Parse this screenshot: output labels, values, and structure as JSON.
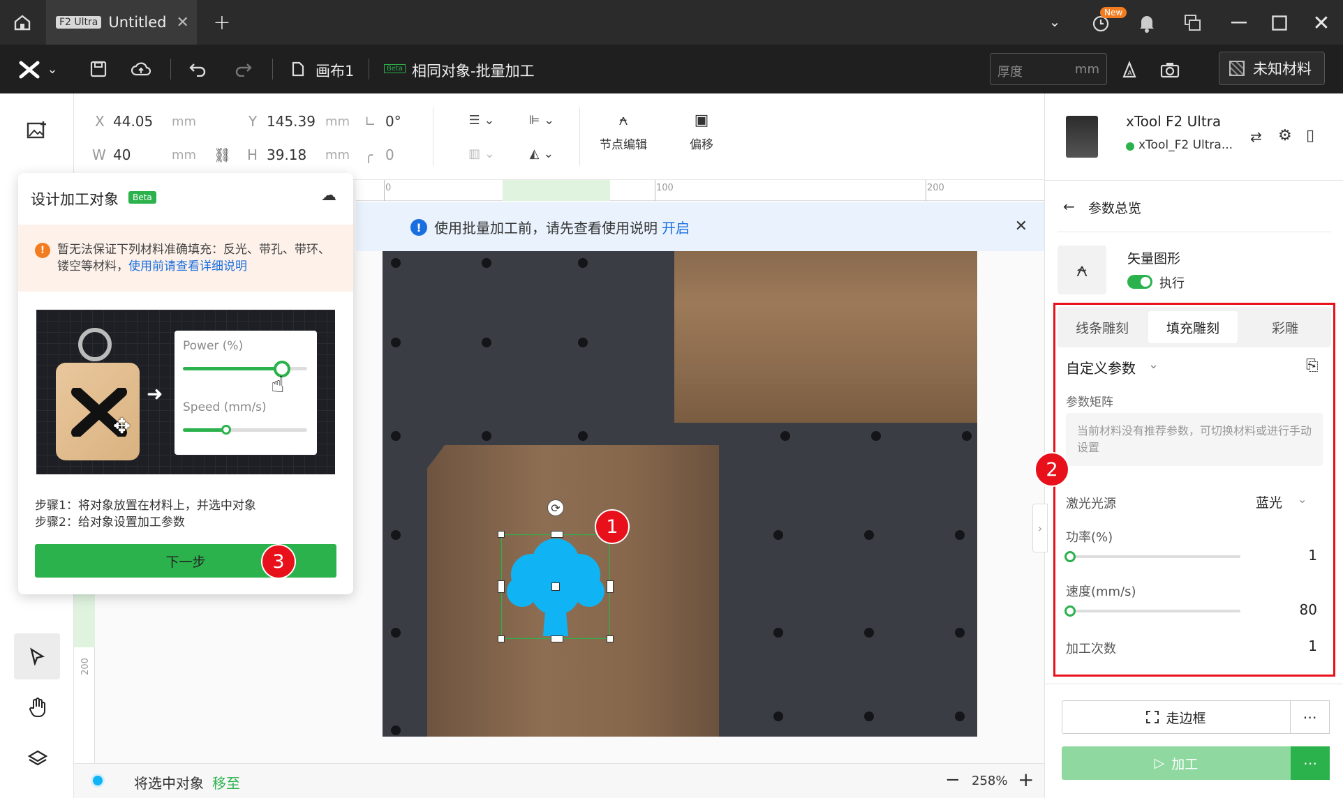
{
  "titlebar": {
    "device_chip": "F2 Ultra",
    "tab_title": "Untitled",
    "new_badge": "New"
  },
  "toolbar": {
    "canvas_name": "画布1",
    "beta": "Beta",
    "batch_title": "相同对象-批量加工",
    "thickness_placeholder": "厚度",
    "thickness_unit": "mm",
    "material": "未知材料"
  },
  "props": {
    "x_label": "X",
    "x": "44.05",
    "y_label": "Y",
    "y": "145.39",
    "w_label": "W",
    "w": "40",
    "h_label": "H",
    "h": "39.18",
    "unit": "mm",
    "rotation": "0°",
    "corner": "0",
    "node_edit": "节点编辑",
    "offset": "偏移"
  },
  "ruler": {
    "t0": "0",
    "t100": "100",
    "t200": "200",
    "l200": "200"
  },
  "banner": {
    "text": "使用批量加工前，请先查看使用说明",
    "link": "开启"
  },
  "popup": {
    "title": "设计加工对象",
    "beta": "Beta",
    "warning": "暂无法保证下列材料准确填充：反光、带孔、带环、镂空等材料，",
    "warning_link": "使用前请查看详细说明",
    "power_label": "Power (%)",
    "speed_label": "Speed (mm/s)",
    "power_level": 0.8,
    "speed_level": 0.35,
    "step1": "步骤1：将对象放置在材料上，并选中对象",
    "step2": "步骤2：给对象设置加工参数",
    "next": "下一步"
  },
  "badges": {
    "b1": "1",
    "b2": "2",
    "b3": "3"
  },
  "device": {
    "name": "xTool F2 Ultra",
    "sub": "xTool_F2 Ultra..."
  },
  "panel": {
    "back_title": "参数总览",
    "object_type": "矢量图形",
    "execute": "执行",
    "tabs": [
      "线条雕刻",
      "填充雕刻",
      "彩雕"
    ],
    "active_tab": 1,
    "preset": "自定义参数",
    "matrix_label": "参数矩阵",
    "matrix_hint": "当前材料没有推荐参数，可切换材料或进行手动设置",
    "laser_label": "激光光源",
    "laser_value": "蓝光",
    "power_label": "功率(%)",
    "power_value": "1",
    "speed_label": "速度(mm/s)",
    "speed_value": "80",
    "passes_label": "加工次数",
    "passes_value": "1",
    "frame": "走边框",
    "process": "加工"
  },
  "status": {
    "text": "将选中对象",
    "move": "移至",
    "zoom": "258%"
  }
}
